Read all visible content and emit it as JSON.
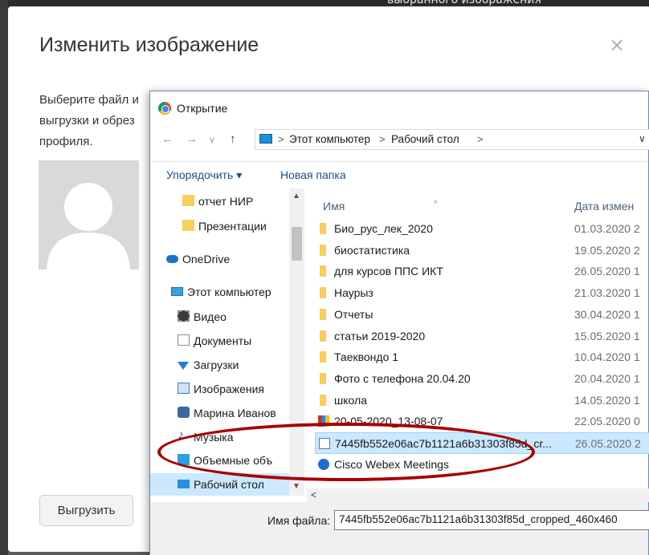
{
  "background": {
    "top_text": "выбранного изображения"
  },
  "modal": {
    "title": "Изменить изображение",
    "close": "×",
    "desc_lines": [
      "Выберите файл и",
      "выгрузки и обрез",
      "профиля."
    ],
    "desc_red": "",
    "upload_label": "Выгрузить"
  },
  "dialog": {
    "title": "Открытие",
    "nav": {
      "back": "←",
      "forward": "→",
      "dropdown": "∨",
      "up": "↑"
    },
    "breadcrumb": [
      "Этот компьютер",
      "Рабочий стол"
    ],
    "breadcrumb_sep": ">",
    "addr_dropdown": "∨",
    "toolbar": {
      "organize": "Упорядочить ▾",
      "new_folder": "Новая папка"
    },
    "nav_items": [
      {
        "label": "отчет НИР",
        "icon": "folder-icon"
      },
      {
        "label": "Презентации",
        "icon": "folder-icon"
      },
      {
        "label": "OneDrive",
        "icon": "cloud-icon"
      },
      {
        "label": "Этот компьютер",
        "icon": "computer-icon"
      },
      {
        "label": "Видео",
        "icon": "video-icon"
      },
      {
        "label": "Документы",
        "icon": "documents-icon"
      },
      {
        "label": "Загрузки",
        "icon": "download-icon"
      },
      {
        "label": "Изображения",
        "icon": "pictures-icon"
      },
      {
        "label": "Марина Иванов",
        "icon": "contact-icon"
      },
      {
        "label": "Музыка",
        "icon": "music-icon"
      },
      {
        "label": "Объемные объ",
        "icon": "3d-objects-icon"
      },
      {
        "label": "Рабочий стол",
        "icon": "desktop-icon",
        "selected": true
      }
    ],
    "columns": {
      "name": "Имя",
      "date": "Дата измен"
    },
    "files": [
      {
        "name": "Био_рус_лек_2020",
        "date": "01.03.2020 2",
        "type": "folder"
      },
      {
        "name": "биостатистика",
        "date": "19.05.2020 2",
        "type": "folder"
      },
      {
        "name": "для курсов ППС ИКТ",
        "date": "26.05.2020 1",
        "type": "folder"
      },
      {
        "name": "Наурыз",
        "date": "21.03.2020 1",
        "type": "folder"
      },
      {
        "name": "Отчеты",
        "date": "30.04.2020 1",
        "type": "folder"
      },
      {
        "name": "статьи 2019-2020",
        "date": "15.05.2020 1",
        "type": "folder"
      },
      {
        "name": "Таеквондо 1",
        "date": "10.04.2020 1",
        "type": "folder"
      },
      {
        "name": "Фото с телефона 20.04.20",
        "date": "20.04.2020 1",
        "type": "folder"
      },
      {
        "name": "школа",
        "date": "14.05.2020 1",
        "type": "folder"
      },
      {
        "name": "20-05-2020_13-08-07",
        "date": "22.05.2020 0",
        "type": "archive"
      },
      {
        "name": "7445fb552e06ac7b1121a6b31303f85d_cr...",
        "date": "26.05.2020 2",
        "type": "image",
        "selected": true
      },
      {
        "name": "Cisco Webex Meetings",
        "date": "",
        "type": "app"
      }
    ],
    "filename_label": "Имя файла:",
    "filename_value": "7445fb552e06ac7b1121a6b31303f85d_cropped_460x460"
  },
  "colors": {
    "selection": "#cce8ff",
    "highlight_ellipse": "#a80000",
    "folder": "#f7cf5b",
    "link_blue": "#1f4d8a"
  }
}
